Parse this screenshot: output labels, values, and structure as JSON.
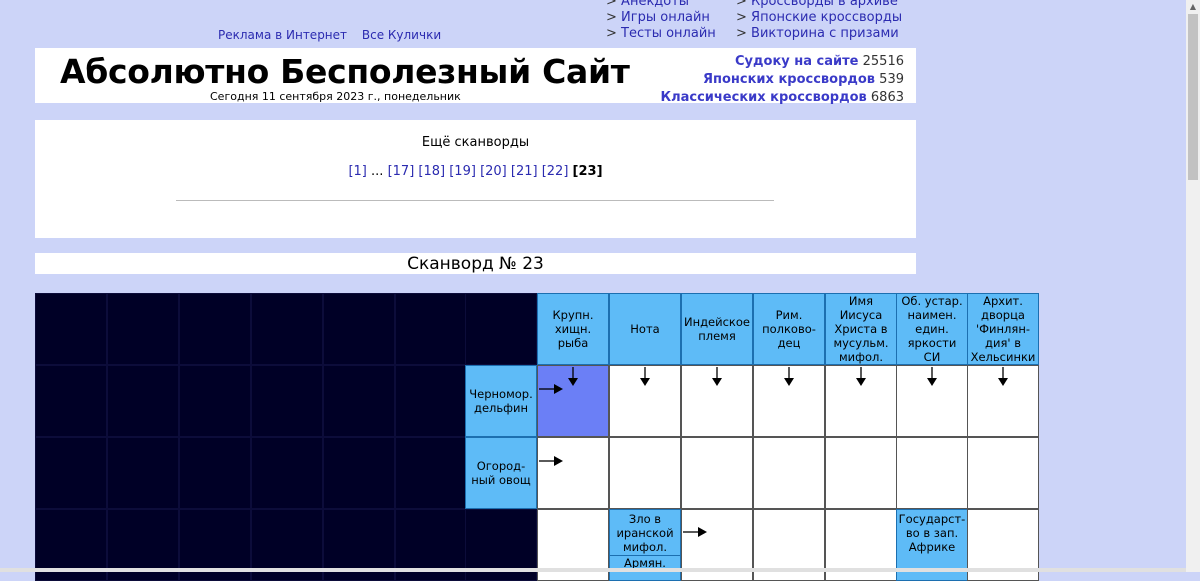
{
  "topnav": {
    "col1": [
      "Анекдоты",
      "Игры онлайн",
      "Тесты онлайн"
    ],
    "col2": [
      "Кроссворды в архиве",
      "Японские кроссворды",
      "Викторина с призами"
    ],
    "marker": ">"
  },
  "toplinks": [
    "Реклама в Интернет",
    "Все Кулички"
  ],
  "header": {
    "title": "Абсолютно Бесполезный Сайт",
    "today": "Сегодня 11 сентября 2023 г., понедельник",
    "stats": [
      {
        "label": "Судоку на сайте",
        "value": "25516"
      },
      {
        "label": "Японских кроссвордов",
        "value": "539"
      },
      {
        "label": "Классических кроссвордов",
        "value": "6863"
      }
    ]
  },
  "more": {
    "title": "Ещё сканворды",
    "pages": [
      "[1]",
      "...",
      "[17]",
      "[18]",
      "[19]",
      "[20]",
      "[21]",
      "[22]",
      "[23]"
    ],
    "current": "[23]"
  },
  "scanword_title": "Сканворд № 23",
  "grid": {
    "column_clues": [
      "Крупн. хищн. рыба",
      "Нота",
      "Индейское племя",
      "Рим. полково-дец",
      "Имя Иисуса Христа в мусульм. мифол.",
      "Об. устар. наимен. един. яркости СИ",
      "Архит. дворца 'Финлян-дия' в Хельсинки"
    ],
    "row_clues": [
      "Черномор. дельфин",
      "Огород-ный овощ"
    ],
    "mid_clue_top": "Зло в иранской мифол.",
    "mid_clue_bottom": "Армян.",
    "mid_clue2": "Государст-во в зап. Африке"
  },
  "colors": {
    "background": "#ccd4f8",
    "clue": "#5ebbf7",
    "dark": "#000026",
    "highlight": "#6b7ff6",
    "link": "#2b2bb0"
  }
}
